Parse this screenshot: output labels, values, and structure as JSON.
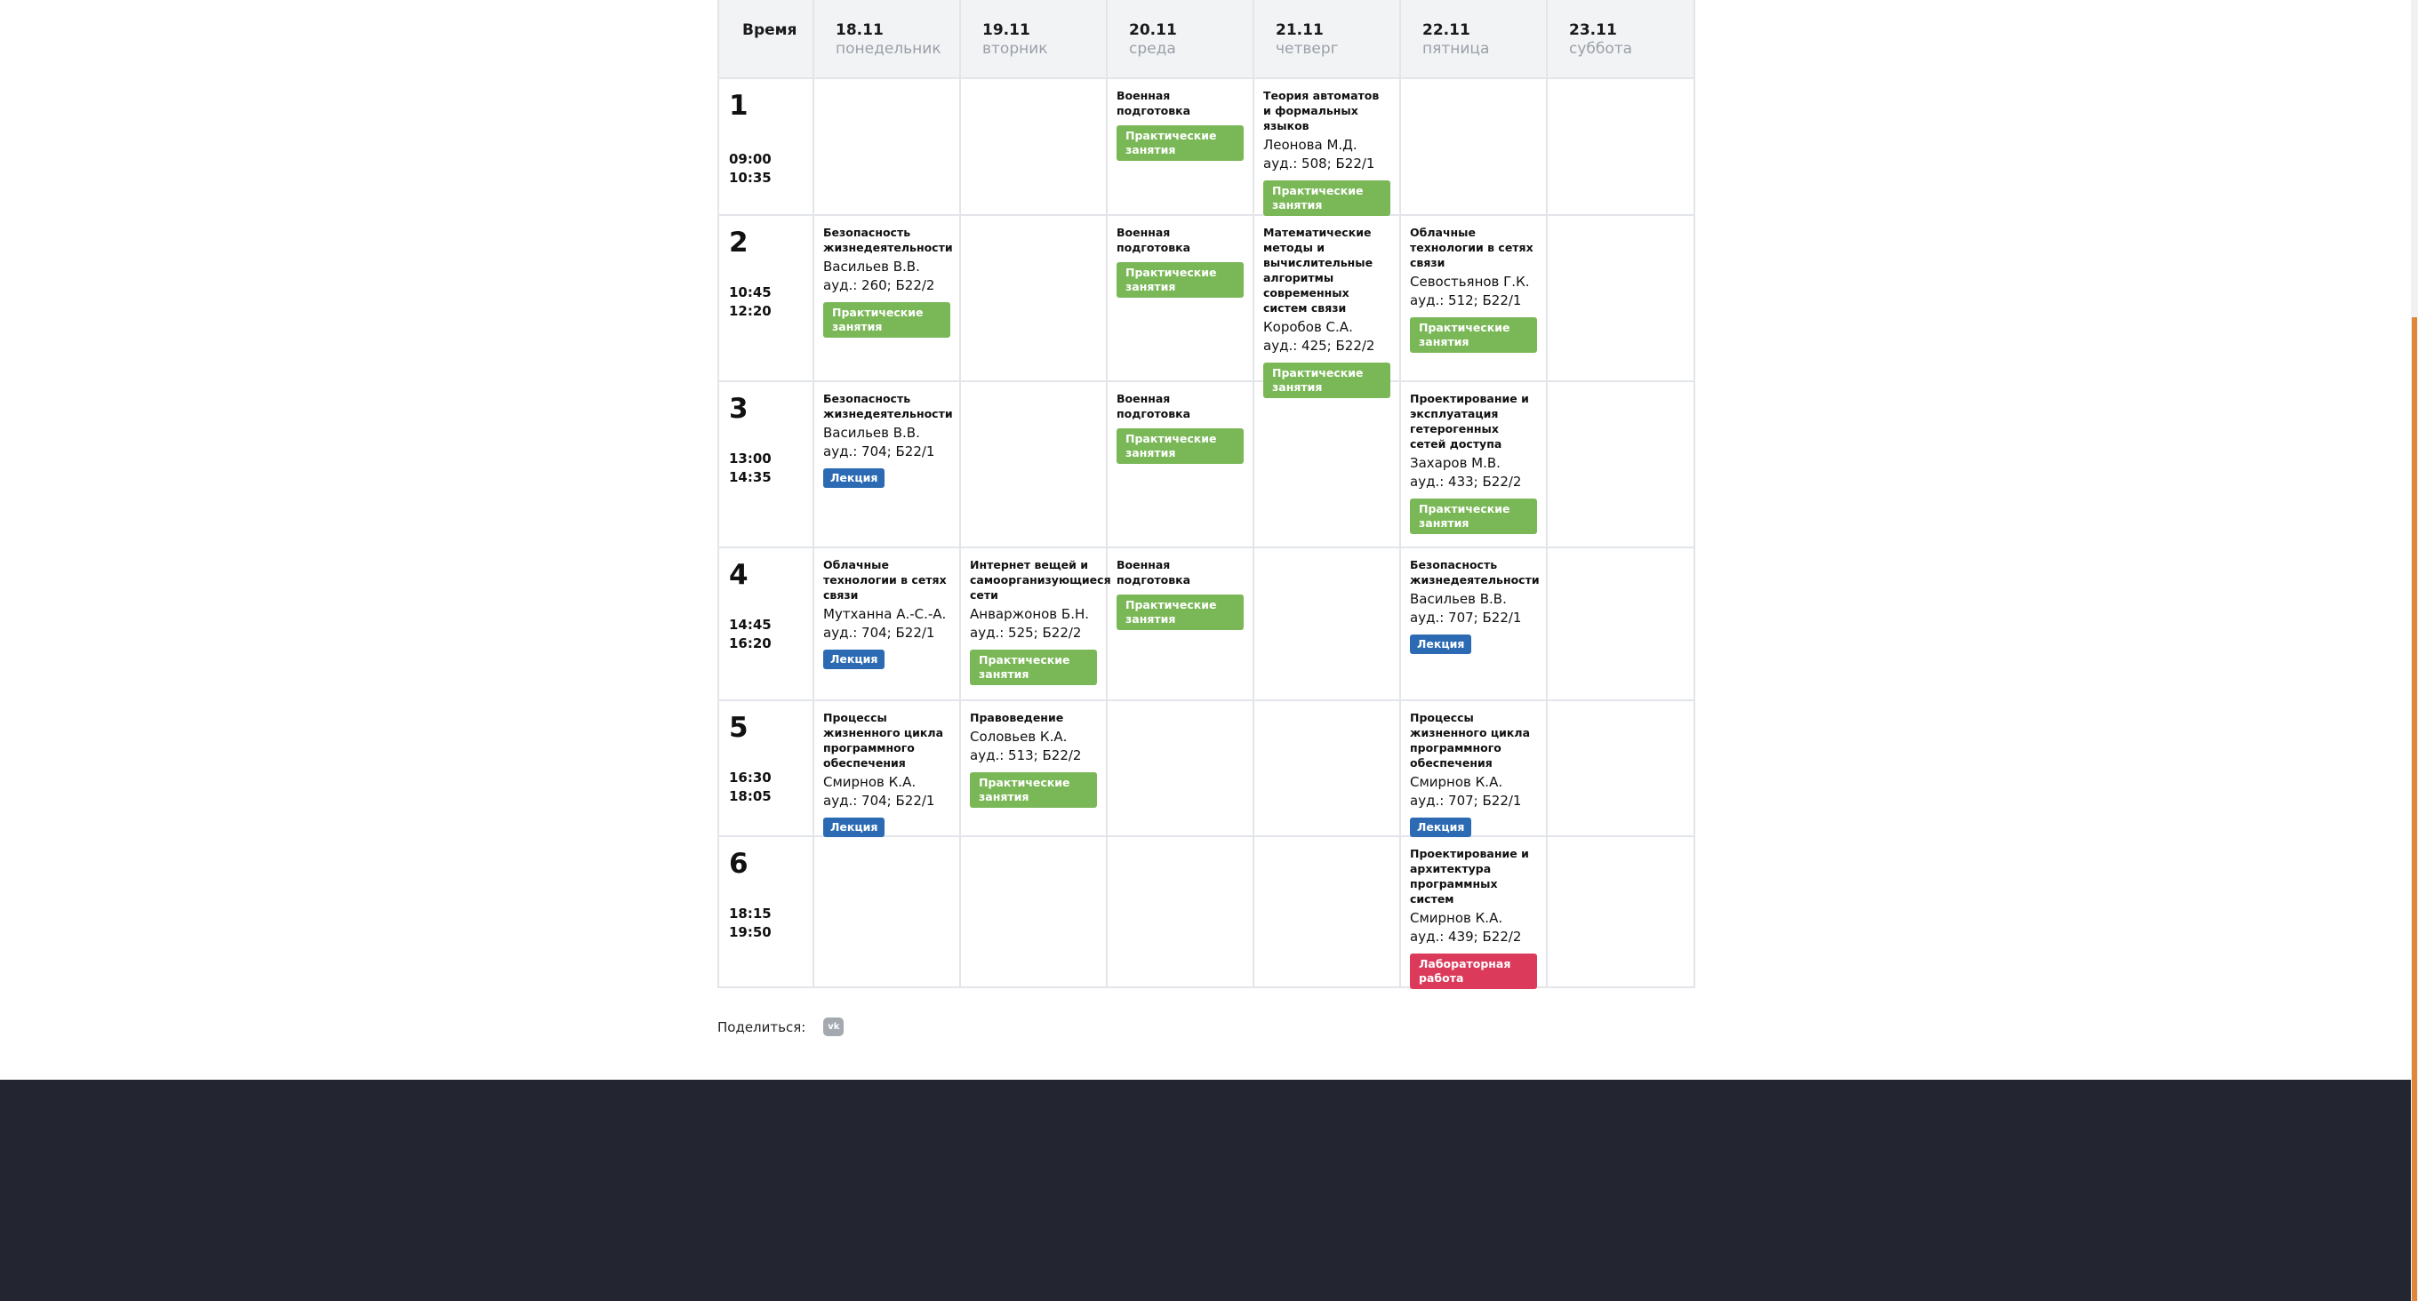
{
  "header": {
    "time_label": "Время",
    "days": [
      {
        "date": "18.11",
        "weekday": "понедельник"
      },
      {
        "date": "19.11",
        "weekday": "вторник"
      },
      {
        "date": "20.11",
        "weekday": "среда"
      },
      {
        "date": "21.11",
        "weekday": "четверг"
      },
      {
        "date": "22.11",
        "weekday": "пятница"
      },
      {
        "date": "23.11",
        "weekday": "суббота"
      }
    ]
  },
  "pairs": [
    {
      "num": "1",
      "start": "09:00",
      "end": "10:35"
    },
    {
      "num": "2",
      "start": "10:45",
      "end": "12:20"
    },
    {
      "num": "3",
      "start": "13:00",
      "end": "14:35"
    },
    {
      "num": "4",
      "start": "14:45",
      "end": "16:20"
    },
    {
      "num": "5",
      "start": "16:30",
      "end": "18:05"
    },
    {
      "num": "6",
      "start": "18:15",
      "end": "19:50"
    }
  ],
  "lessons": {
    "r1_wed": {
      "subject": "Военная подготовка",
      "type": "Практические занятия"
    },
    "r1_thu": {
      "subject": "Теория автоматов и формальных языков",
      "teacher": "Леонова М.Д.",
      "room": "ауд.: 508; Б22/1",
      "type": "Практические занятия"
    },
    "r2_mon": {
      "subject": "Безопасность жизнедеятельности",
      "teacher": "Васильев В.В.",
      "room": "ауд.: 260; Б22/2",
      "type": "Практические занятия"
    },
    "r2_wed": {
      "subject": "Военная подготовка",
      "type": "Практические занятия"
    },
    "r2_thu": {
      "subject": "Математические методы и вычислительные алгоритмы современных систем связи",
      "teacher": "Коробов С.А.",
      "room": "ауд.: 425; Б22/2",
      "type": "Практические занятия"
    },
    "r2_fri": {
      "subject": "Облачные технологии в сетях связи",
      "teacher": "Севостьянов Г.К.",
      "room": "ауд.: 512; Б22/1",
      "type": "Практические занятия"
    },
    "r3_mon": {
      "subject": "Безопасность жизнедеятельности",
      "teacher": "Васильев В.В.",
      "room": "ауд.: 704; Б22/1",
      "type": "Лекция"
    },
    "r3_wed": {
      "subject": "Военная подготовка",
      "type": "Практические занятия"
    },
    "r3_fri": {
      "subject": "Проектирование и эксплуатация гетерогенных сетей доступа",
      "teacher": "Захаров М.В.",
      "room": "ауд.: 433; Б22/2",
      "type": "Практические занятия"
    },
    "r4_mon": {
      "subject": "Облачные технологии в сетях связи",
      "teacher": "Мутханна А.-С.-А.",
      "room": "ауд.: 704; Б22/1",
      "type": "Лекция"
    },
    "r4_tue": {
      "subject": "Интернет вещей и самоорганизующиеся сети",
      "teacher": "Анваржонов Б.Н.",
      "room": "ауд.: 525; Б22/2",
      "type": "Практические занятия"
    },
    "r4_wed": {
      "subject": "Военная подготовка",
      "type": "Практические занятия"
    },
    "r4_fri": {
      "subject": "Безопасность жизнедеятельности",
      "teacher": "Васильев В.В.",
      "room": "ауд.: 707; Б22/1",
      "type": "Лекция"
    },
    "r5_mon": {
      "subject": "Процессы жизненного цикла программного обеспечения",
      "teacher": "Смирнов К.А.",
      "room": "ауд.: 704; Б22/1",
      "type": "Лекция"
    },
    "r5_tue": {
      "subject": "Правоведение",
      "teacher": "Соловьев К.А.",
      "room": "ауд.: 513; Б22/2",
      "type": "Практические занятия"
    },
    "r5_fri": {
      "subject": "Процессы жизненного цикла программного обеспечения",
      "teacher": "Смирнов К.А.",
      "room": "ауд.: 707; Б22/1",
      "type": "Лекция"
    },
    "r6_fri": {
      "subject": "Проектирование и архитектура программных систем",
      "teacher": "Смирнов К.А.",
      "room": "ауд.: 439; Б22/2",
      "type": "Лабораторная работа"
    }
  },
  "share": {
    "label": "Поделиться:",
    "vk_icon_text": "vk"
  },
  "colors": {
    "practice": "#7ab857",
    "lecture": "#2c6bb4",
    "lab": "#dc3a5a",
    "footer": "#232630",
    "scroll_thumb": "#e0863a"
  }
}
